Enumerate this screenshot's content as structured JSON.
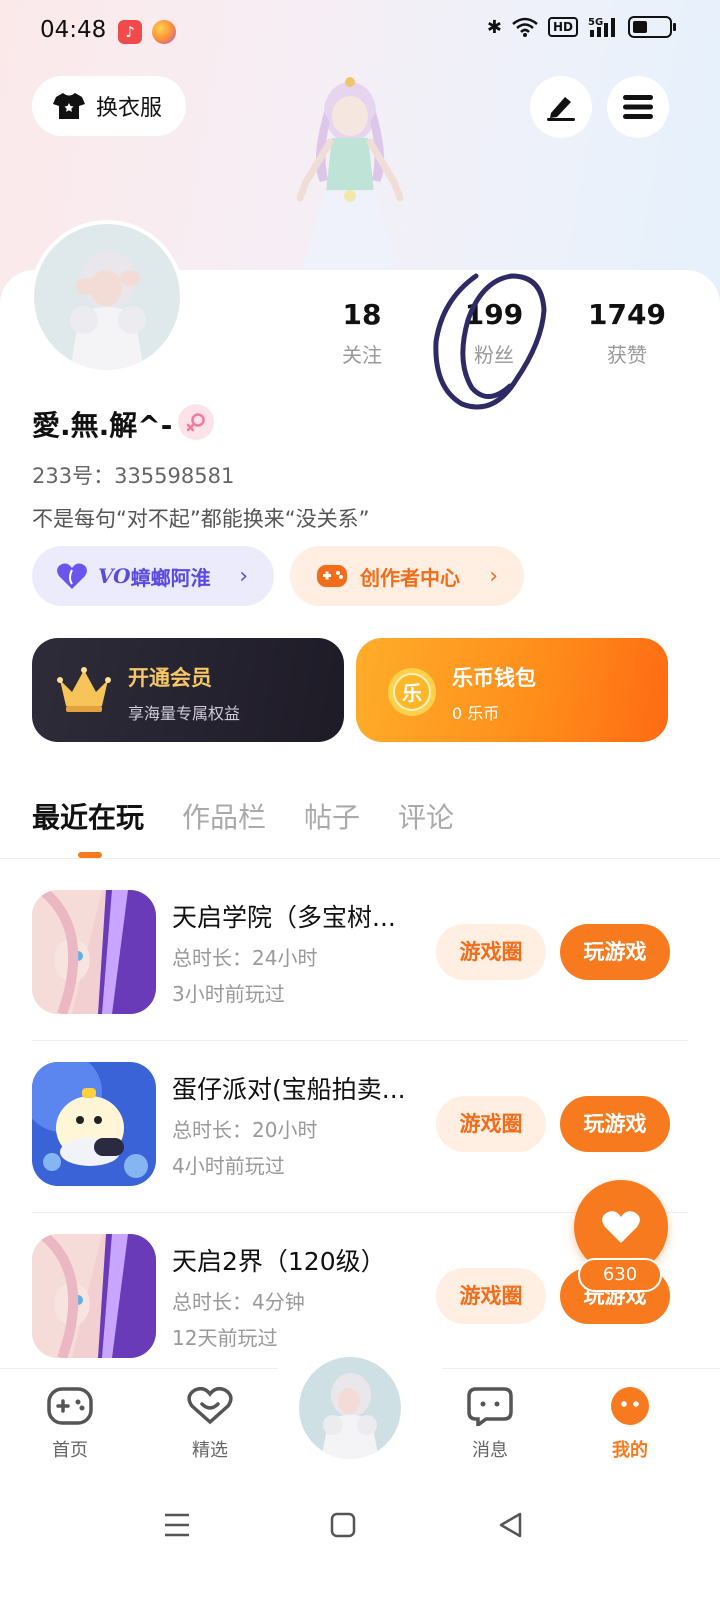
{
  "status_bar": {
    "time": "04:48",
    "network": "5G"
  },
  "header": {
    "outfit_label": "换衣服"
  },
  "profile": {
    "name": "愛.無.解^-",
    "id_label": "233号：335598581",
    "bio": "不是每句“对不起”都能换来“没关系”",
    "stats": [
      {
        "value": "18",
        "label": "关注"
      },
      {
        "value": "199",
        "label": "粉丝"
      },
      {
        "value": "1749",
        "label": "获赞"
      }
    ]
  },
  "tags": {
    "vo_prefix": "VO",
    "vo_label": "蟑螂阿淮",
    "creator_label": "创作者中心"
  },
  "cards": {
    "vip_title": "开通会员",
    "vip_sub": "享海量专属权益",
    "wallet_title": "乐币钱包",
    "wallet_sub": "0 乐币",
    "coin_char": "乐"
  },
  "tabs": [
    "最近在玩",
    "作品栏",
    "帖子",
    "评论"
  ],
  "games": [
    {
      "title": "天启学院（多宝树...",
      "duration": "总时长：24小时",
      "last_played": "3小时前玩过",
      "circle_label": "游戏圈",
      "play_label": "玩游戏"
    },
    {
      "title": "蛋仔派对(宝船拍卖...",
      "duration": "总时长：20小时",
      "last_played": "4小时前玩过",
      "circle_label": "游戏圈",
      "play_label": "玩游戏"
    },
    {
      "title": "天启2界（120级）",
      "duration": "总时长：4分钟",
      "last_played": "12天前玩过",
      "circle_label": "游戏圈",
      "play_label": "玩游戏"
    }
  ],
  "fab": {
    "count": "630"
  },
  "bottom_nav": [
    {
      "label": "首页"
    },
    {
      "label": "精选"
    },
    {
      "label": "消息"
    },
    {
      "label": "我的"
    }
  ],
  "colors": {
    "accent": "#f77a1e",
    "vo_purple": "#5a4be0",
    "vip_gold": "#f4c767"
  }
}
